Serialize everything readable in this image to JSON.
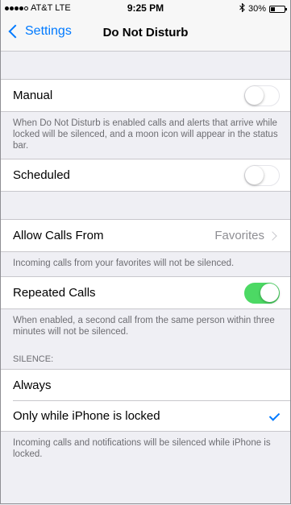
{
  "status_bar": {
    "carrier": "AT&T",
    "network": "LTE",
    "time": "9:25 PM",
    "bluetooth_icon": "bluetooth-icon",
    "battery_percent": "30%",
    "battery_level": 0.3
  },
  "nav": {
    "back_label": "Settings",
    "title": "Do Not Disturb"
  },
  "manual": {
    "label": "Manual",
    "enabled": false,
    "footer": "When Do Not Disturb is enabled calls and alerts that arrive while locked will be silenced, and a moon icon will appear in the status bar."
  },
  "scheduled": {
    "label": "Scheduled",
    "enabled": false
  },
  "allow_calls": {
    "label": "Allow Calls From",
    "value": "Favorites",
    "footer": "Incoming calls from your favorites will not be silenced."
  },
  "repeated_calls": {
    "label": "Repeated Calls",
    "enabled": true,
    "footer": "When enabled, a second call from the same person within three minutes will not be silenced."
  },
  "silence": {
    "header": "SILENCE:",
    "options": [
      {
        "label": "Always",
        "selected": false
      },
      {
        "label": "Only while iPhone is locked",
        "selected": true
      }
    ],
    "footer": "Incoming calls and notifications will be silenced while iPhone is locked."
  },
  "colors": {
    "accent": "#007aff",
    "toggle_on": "#4cd964",
    "background": "#efeff4"
  }
}
